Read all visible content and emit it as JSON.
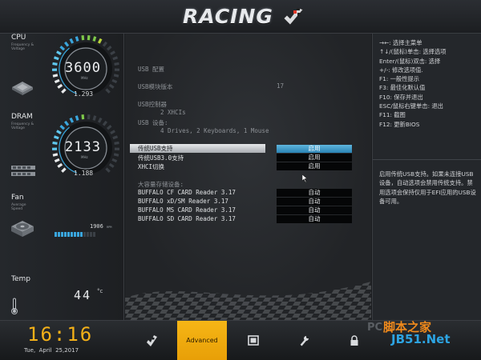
{
  "header": {
    "logo": "RACING"
  },
  "left": {
    "cpu": {
      "title": "CPU",
      "sub1": "Frequency &",
      "sub2": "Voltage",
      "value": "3600",
      "unit": "MHz",
      "voltage": "1.293",
      "level": 0.62
    },
    "dram": {
      "title": "DRAM",
      "sub1": "Frequency &",
      "sub2": "Voltage",
      "value": "2133",
      "unit": "MHz",
      "voltage": "1.188",
      "level": 0.5
    },
    "fan": {
      "title": "Fan",
      "sub1": "Average",
      "sub2": "Speed",
      "rpm": "1906",
      "rpm_unit": "RPM",
      "level": 0.62
    },
    "temp": {
      "title": "Temp",
      "value": "44",
      "unit": "°c"
    }
  },
  "main": {
    "usb_config": "USB 配置",
    "usb_module_label": "USB模块版本",
    "usb_module_value": "17",
    "usb_ctrl_label": "USB控制器",
    "usb_ctrl_value": "2 XHCIs",
    "usb_dev_label": "USB 设备:",
    "usb_dev_value": "4 Drives, 2 Keyboards, 1 Mouse",
    "settings": [
      {
        "label": "传统USB支持",
        "value": "启用"
      },
      {
        "label": "传统USB3.0支持",
        "value": "启用"
      },
      {
        "label": "XHCI切换",
        "value": "启用"
      }
    ],
    "mass_title": "大容量存储设备:",
    "mass": [
      {
        "label": "BUFFALO CF CARD Reader 3.17",
        "value": "自动"
      },
      {
        "label": "BUFFALO xD/SM Reader 3.17",
        "value": "自动"
      },
      {
        "label": "BUFFALO MS CARD Reader 3.17",
        "value": "自动"
      },
      {
        "label": "BUFFALO SD CARD Reader 3.17",
        "value": "自动"
      }
    ]
  },
  "help": {
    "keys": [
      "→←: 选择主菜单",
      "↑↓/(鼠标)单击: 选择选项",
      "Enter/(鼠标)双击: 选择",
      "+/-: 修改选项值.",
      "F1: 一般性提示",
      "F3: 最佳化默认值",
      "F10: 保存并退出",
      "ESC/鼠标右键单击: 退出",
      "F11: 截图",
      "F12: 更新BIOS"
    ],
    "description": "启用传统USB支持。如果未连接USB设备，自动选项会禁用传统支持。禁用选项会保持仅用于EFI应用的USB设备可用。"
  },
  "footer": {
    "time": "16:16",
    "date": "Tue,  April  25,2017",
    "active_tab": "Advanced",
    "watermark_pc": "PC",
    "watermark_site": "脚本之家",
    "watermark_url": "JB51.Net"
  },
  "colors": {
    "accent": "#f6b616",
    "gauge_blue": "#3aa6dd",
    "select_blue": "#2a84b5"
  }
}
